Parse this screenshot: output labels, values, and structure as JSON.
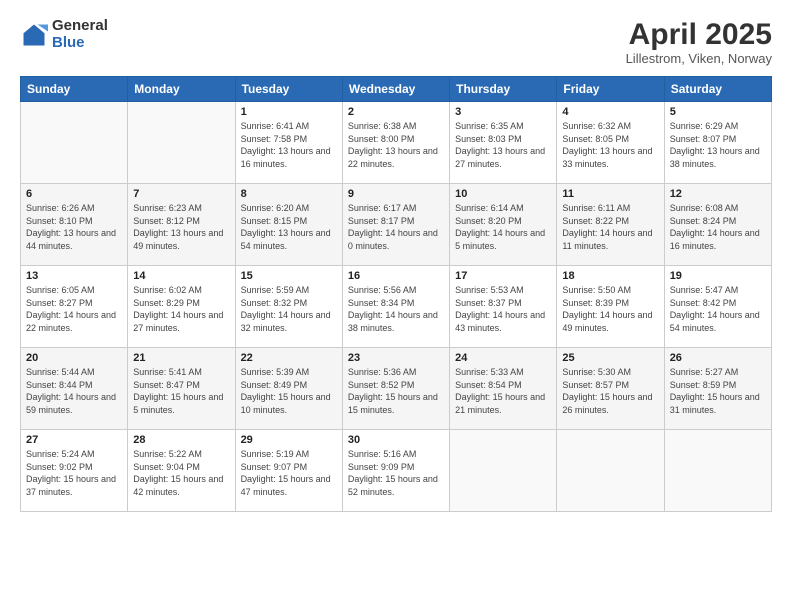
{
  "header": {
    "logo_general": "General",
    "logo_blue": "Blue",
    "title": "April 2025",
    "subtitle": "Lillestrom, Viken, Norway"
  },
  "days_of_week": [
    "Sunday",
    "Monday",
    "Tuesday",
    "Wednesday",
    "Thursday",
    "Friday",
    "Saturday"
  ],
  "weeks": [
    [
      {
        "day": "",
        "info": ""
      },
      {
        "day": "",
        "info": ""
      },
      {
        "day": "1",
        "info": "Sunrise: 6:41 AM\nSunset: 7:58 PM\nDaylight: 13 hours and 16 minutes."
      },
      {
        "day": "2",
        "info": "Sunrise: 6:38 AM\nSunset: 8:00 PM\nDaylight: 13 hours and 22 minutes."
      },
      {
        "day": "3",
        "info": "Sunrise: 6:35 AM\nSunset: 8:03 PM\nDaylight: 13 hours and 27 minutes."
      },
      {
        "day": "4",
        "info": "Sunrise: 6:32 AM\nSunset: 8:05 PM\nDaylight: 13 hours and 33 minutes."
      },
      {
        "day": "5",
        "info": "Sunrise: 6:29 AM\nSunset: 8:07 PM\nDaylight: 13 hours and 38 minutes."
      }
    ],
    [
      {
        "day": "6",
        "info": "Sunrise: 6:26 AM\nSunset: 8:10 PM\nDaylight: 13 hours and 44 minutes."
      },
      {
        "day": "7",
        "info": "Sunrise: 6:23 AM\nSunset: 8:12 PM\nDaylight: 13 hours and 49 minutes."
      },
      {
        "day": "8",
        "info": "Sunrise: 6:20 AM\nSunset: 8:15 PM\nDaylight: 13 hours and 54 minutes."
      },
      {
        "day": "9",
        "info": "Sunrise: 6:17 AM\nSunset: 8:17 PM\nDaylight: 14 hours and 0 minutes."
      },
      {
        "day": "10",
        "info": "Sunrise: 6:14 AM\nSunset: 8:20 PM\nDaylight: 14 hours and 5 minutes."
      },
      {
        "day": "11",
        "info": "Sunrise: 6:11 AM\nSunset: 8:22 PM\nDaylight: 14 hours and 11 minutes."
      },
      {
        "day": "12",
        "info": "Sunrise: 6:08 AM\nSunset: 8:24 PM\nDaylight: 14 hours and 16 minutes."
      }
    ],
    [
      {
        "day": "13",
        "info": "Sunrise: 6:05 AM\nSunset: 8:27 PM\nDaylight: 14 hours and 22 minutes."
      },
      {
        "day": "14",
        "info": "Sunrise: 6:02 AM\nSunset: 8:29 PM\nDaylight: 14 hours and 27 minutes."
      },
      {
        "day": "15",
        "info": "Sunrise: 5:59 AM\nSunset: 8:32 PM\nDaylight: 14 hours and 32 minutes."
      },
      {
        "day": "16",
        "info": "Sunrise: 5:56 AM\nSunset: 8:34 PM\nDaylight: 14 hours and 38 minutes."
      },
      {
        "day": "17",
        "info": "Sunrise: 5:53 AM\nSunset: 8:37 PM\nDaylight: 14 hours and 43 minutes."
      },
      {
        "day": "18",
        "info": "Sunrise: 5:50 AM\nSunset: 8:39 PM\nDaylight: 14 hours and 49 minutes."
      },
      {
        "day": "19",
        "info": "Sunrise: 5:47 AM\nSunset: 8:42 PM\nDaylight: 14 hours and 54 minutes."
      }
    ],
    [
      {
        "day": "20",
        "info": "Sunrise: 5:44 AM\nSunset: 8:44 PM\nDaylight: 14 hours and 59 minutes."
      },
      {
        "day": "21",
        "info": "Sunrise: 5:41 AM\nSunset: 8:47 PM\nDaylight: 15 hours and 5 minutes."
      },
      {
        "day": "22",
        "info": "Sunrise: 5:39 AM\nSunset: 8:49 PM\nDaylight: 15 hours and 10 minutes."
      },
      {
        "day": "23",
        "info": "Sunrise: 5:36 AM\nSunset: 8:52 PM\nDaylight: 15 hours and 15 minutes."
      },
      {
        "day": "24",
        "info": "Sunrise: 5:33 AM\nSunset: 8:54 PM\nDaylight: 15 hours and 21 minutes."
      },
      {
        "day": "25",
        "info": "Sunrise: 5:30 AM\nSunset: 8:57 PM\nDaylight: 15 hours and 26 minutes."
      },
      {
        "day": "26",
        "info": "Sunrise: 5:27 AM\nSunset: 8:59 PM\nDaylight: 15 hours and 31 minutes."
      }
    ],
    [
      {
        "day": "27",
        "info": "Sunrise: 5:24 AM\nSunset: 9:02 PM\nDaylight: 15 hours and 37 minutes."
      },
      {
        "day": "28",
        "info": "Sunrise: 5:22 AM\nSunset: 9:04 PM\nDaylight: 15 hours and 42 minutes."
      },
      {
        "day": "29",
        "info": "Sunrise: 5:19 AM\nSunset: 9:07 PM\nDaylight: 15 hours and 47 minutes."
      },
      {
        "day": "30",
        "info": "Sunrise: 5:16 AM\nSunset: 9:09 PM\nDaylight: 15 hours and 52 minutes."
      },
      {
        "day": "",
        "info": ""
      },
      {
        "day": "",
        "info": ""
      },
      {
        "day": "",
        "info": ""
      }
    ]
  ]
}
